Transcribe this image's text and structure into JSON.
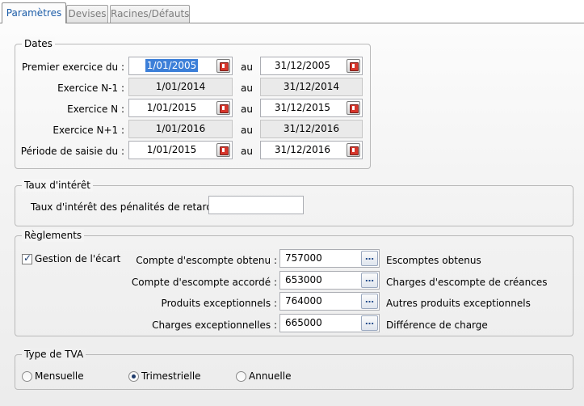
{
  "tabs": [
    {
      "label": "Paramètres"
    },
    {
      "label": "Devises"
    },
    {
      "label": "Racines/Défauts"
    }
  ],
  "dates": {
    "legend": "Dates",
    "au": "au",
    "rows": [
      {
        "label": "Premier exercice du :",
        "from": "1/01/2005",
        "to": "31/12/2005"
      },
      {
        "label": "Exercice N-1 :",
        "from": "1/01/2014",
        "to": "31/12/2014"
      },
      {
        "label": "Exercice N :",
        "from": "1/01/2015",
        "to": "31/12/2015"
      },
      {
        "label": "Exercice N+1 :",
        "from": "1/01/2016",
        "to": "31/12/2016"
      },
      {
        "label": "Période de saisie du :",
        "from": "1/01/2015",
        "to": "31/12/2016"
      }
    ]
  },
  "interest": {
    "legend": "Taux d'intérêt",
    "label": "Taux d'intérêt des pénalités de retard :",
    "value": ""
  },
  "settlements": {
    "legend": "Règlements",
    "gap_checkbox_label": "Gestion de l'écart",
    "dots": "…",
    "rows": [
      {
        "label": "Compte d'escompte obtenu :",
        "value": "757000",
        "desc": "Escomptes obtenus"
      },
      {
        "label": "Compte d'escompte accordé :",
        "value": "653000",
        "desc": "Charges d'escompte de créances"
      },
      {
        "label": "Produits exceptionnels :",
        "value": "764000",
        "desc": "Autres produits exceptionnels"
      },
      {
        "label": "Charges exceptionnelles :",
        "value": "665000",
        "desc": "Différence de charge"
      }
    ]
  },
  "vat": {
    "legend": "Type de TVA",
    "options": [
      {
        "label": "Mensuelle",
        "selected": false
      },
      {
        "label": "Trimestrielle",
        "selected": true
      },
      {
        "label": "Annuelle",
        "selected": false
      }
    ]
  }
}
